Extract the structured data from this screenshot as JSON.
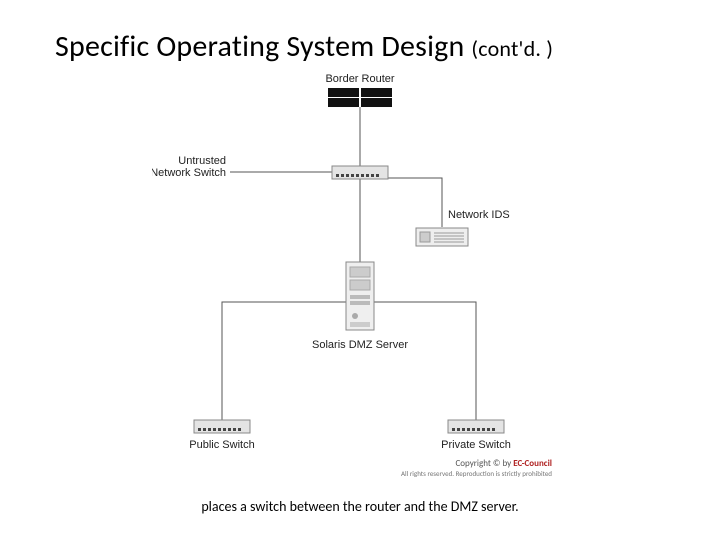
{
  "title_main": "Specific Operating System Design ",
  "title_sub": "(cont'd. )",
  "caption": "places a switch between the router and the DMZ server.",
  "labels": {
    "border_router": "Border Router",
    "untrusted_switch_l1": "Untrusted",
    "untrusted_switch_l2": "Network Switch",
    "network_ids": "Network IDS",
    "dmz_server": "Solaris DMZ Server",
    "public_switch": "Public Switch",
    "private_switch": "Private Switch",
    "copyright_prefix": "Copyright © by ",
    "copyright_brand": "EC-Council",
    "rights": "All rights reserved. Reproduction is strictly prohibited"
  }
}
